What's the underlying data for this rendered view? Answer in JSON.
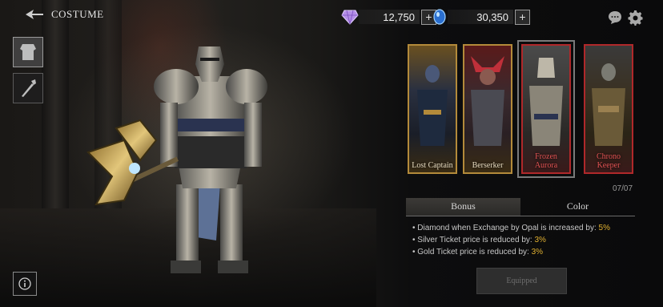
{
  "header": {
    "title": "COSTUME",
    "back_icon": "winged-back-icon"
  },
  "side_tabs": [
    {
      "icon": "armor-icon",
      "active": true
    },
    {
      "icon": "weapon-icon",
      "active": false
    }
  ],
  "currencies": [
    {
      "icon": "diamond-gem-icon",
      "amount": "12,750",
      "color": "#b48ee6"
    },
    {
      "icon": "blue-opal-icon",
      "amount": "30,350",
      "color": "#4aa3f0"
    }
  ],
  "top_icons": [
    "chat-icon",
    "gear-icon"
  ],
  "costumes": [
    {
      "label": "Lost Captain",
      "frame": "gold"
    },
    {
      "label": "Berserker",
      "frame": "gold"
    },
    {
      "label": "Frozen Aurora",
      "frame": "red",
      "selected": true
    },
    {
      "label": "Chrono Keeper",
      "frame": "red"
    }
  ],
  "counter": "07/07",
  "tabs": [
    {
      "label": "Bonus",
      "active": true
    },
    {
      "label": "Color",
      "active": false
    }
  ],
  "bonuses": [
    {
      "text": "Diamond when Exchange by Opal is increased by: ",
      "value": "5%"
    },
    {
      "text": "Silver Ticket price is reduced by: ",
      "value": "3%"
    },
    {
      "text": "Gold Ticket price is reduced by: ",
      "value": "3%"
    }
  ],
  "equip_button": "Equipped",
  "colors": {
    "gold_frame": "#b38a3a",
    "red_frame": "#b0282a",
    "bonus_value": "#e0b030"
  }
}
